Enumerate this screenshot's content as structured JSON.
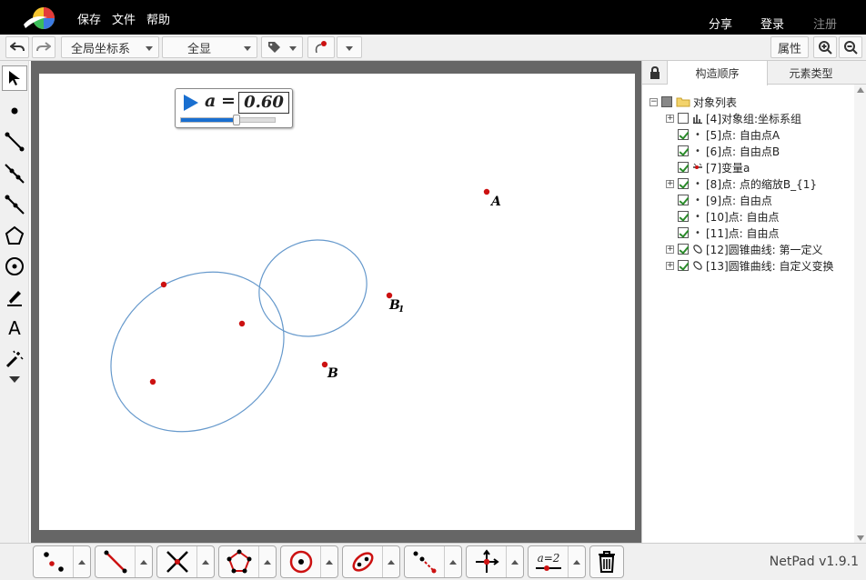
{
  "menu": {
    "save": "保存",
    "file": "文件",
    "help": "帮助",
    "share": "分享",
    "login": "登录",
    "register": "注册"
  },
  "toolbar": {
    "coord_system": "全局坐标系",
    "view_all": "全显",
    "properties": "属性"
  },
  "variable": {
    "name": "a",
    "equals": "=",
    "value": "0.60",
    "slider_fraction": 0.6
  },
  "canvas_labels": {
    "A": "A",
    "B1_main": "B",
    "B1_sub": "1",
    "B": "B"
  },
  "panel": {
    "tab_order": "构造顺序",
    "tab_types": "元素类型",
    "root": "对象列表",
    "items": [
      {
        "label": "[4]对象组:坐标系组",
        "checked": false,
        "expandable": true,
        "icon": "chart-icon"
      },
      {
        "label": "[5]点: 自由点A",
        "checked": true,
        "expandable": false,
        "icon": "point-icon"
      },
      {
        "label": "[6]点: 自由点B",
        "checked": true,
        "expandable": false,
        "icon": "point-icon"
      },
      {
        "label": "[7]变量a",
        "checked": true,
        "expandable": false,
        "icon": "variable-icon"
      },
      {
        "label": "[8]点: 点的缩放B_{1}",
        "checked": true,
        "expandable": true,
        "icon": "point-icon"
      },
      {
        "label": "[9]点: 自由点",
        "checked": true,
        "expandable": false,
        "icon": "point-icon"
      },
      {
        "label": "[10]点: 自由点",
        "checked": true,
        "expandable": false,
        "icon": "point-icon"
      },
      {
        "label": "[11]点: 自由点",
        "checked": true,
        "expandable": false,
        "icon": "point-icon"
      },
      {
        "label": "[12]圆锥曲线: 第一定义",
        "checked": true,
        "expandable": true,
        "icon": "conic-icon"
      },
      {
        "label": "[13]圆锥曲线: 自定义变换",
        "checked": true,
        "expandable": true,
        "icon": "conic-icon"
      }
    ]
  },
  "bottom": {
    "variable_tool_label": "a=2",
    "version": "NetPad v1.9.1"
  },
  "colors": {
    "point": "#cc1111",
    "curve": "#6699cc",
    "accent": "#1a6fd0"
  }
}
